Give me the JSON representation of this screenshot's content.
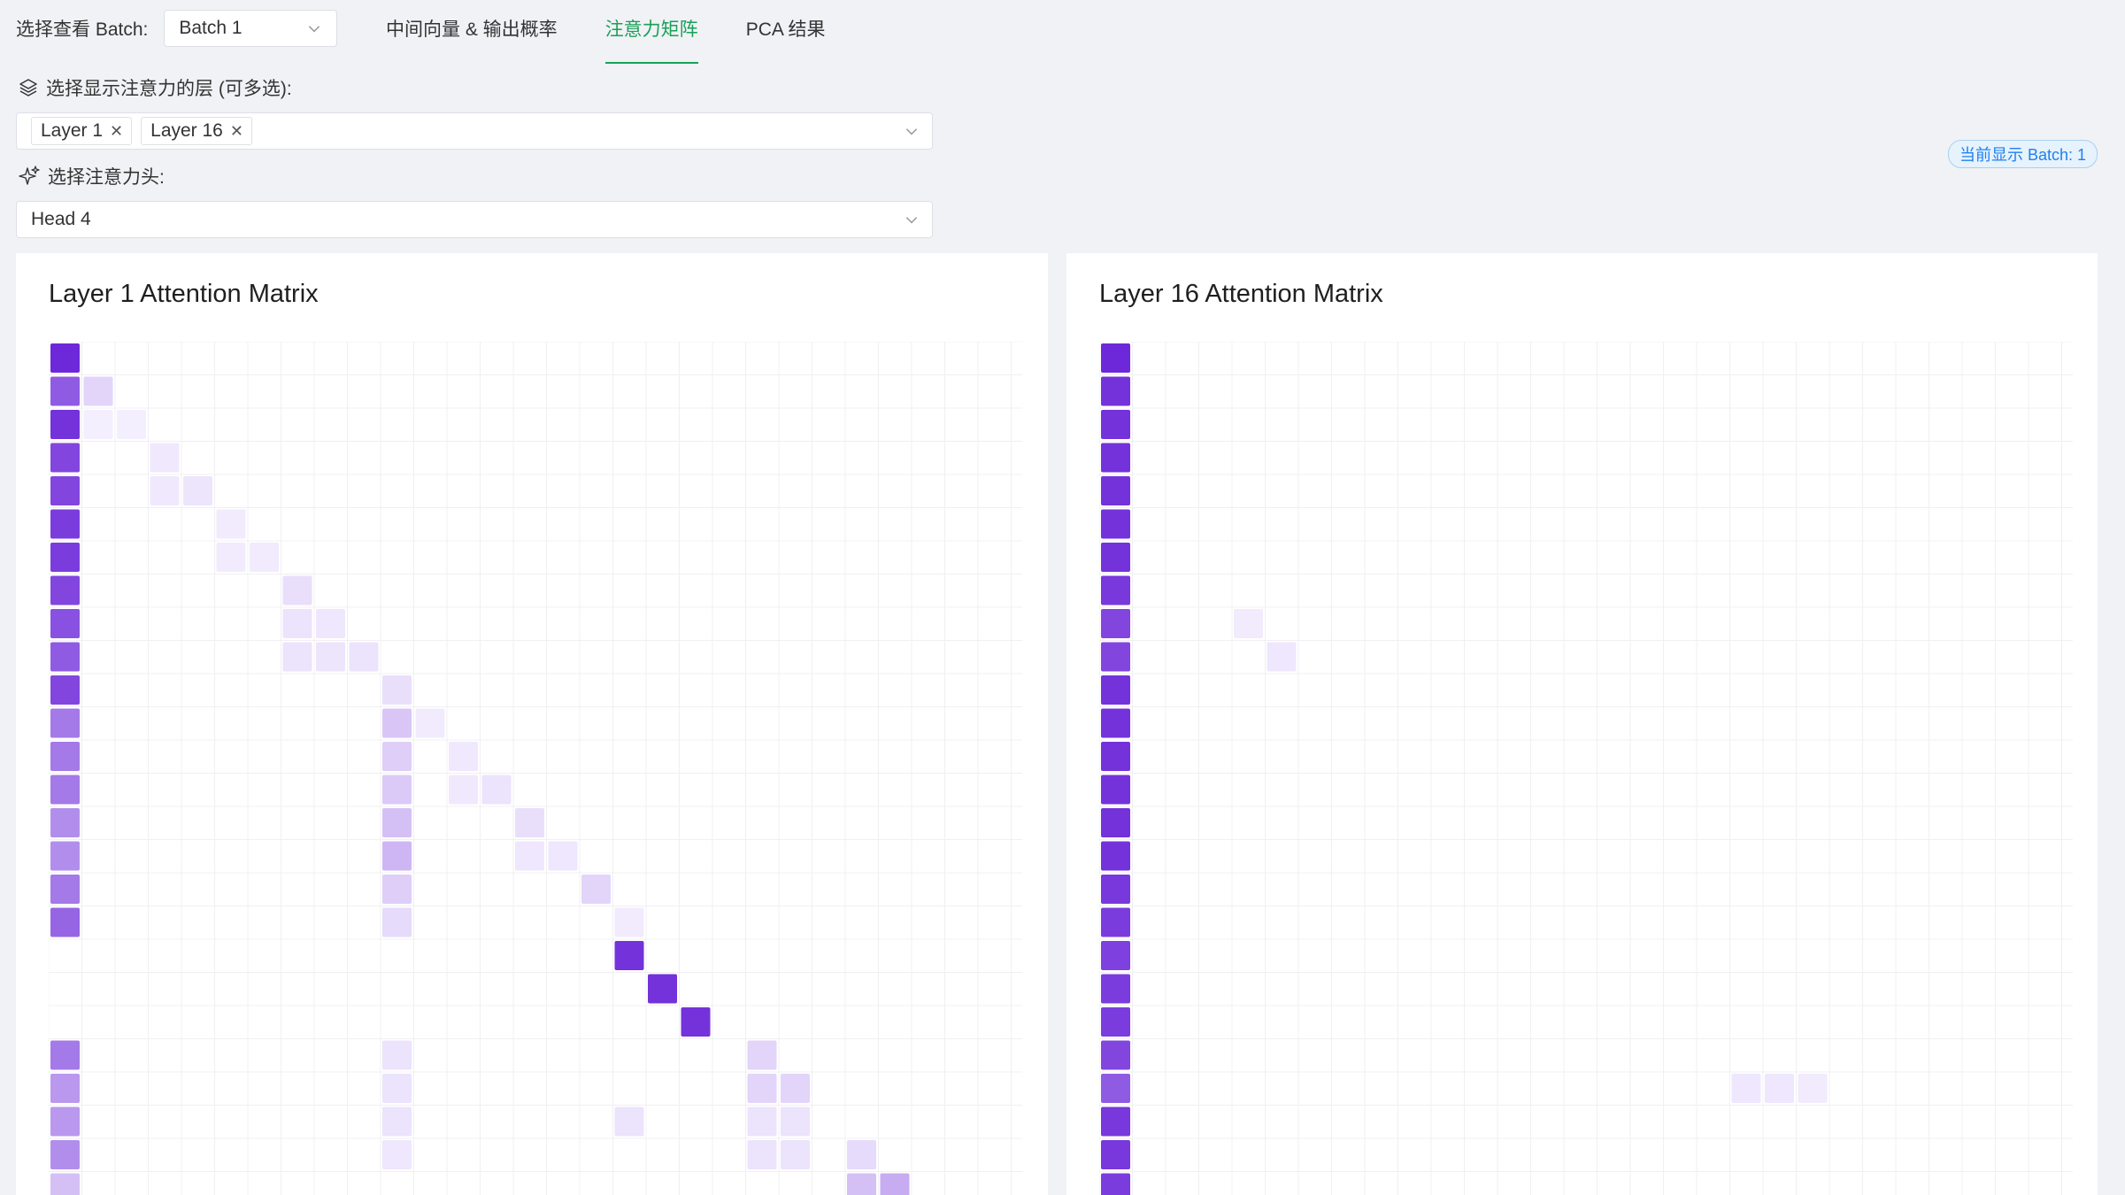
{
  "batch_selector": {
    "label": "选择查看 Batch:",
    "value": "Batch 1"
  },
  "tabs": [
    {
      "label": "中间向量 & 输出概率",
      "active": false
    },
    {
      "label": "注意力矩阵",
      "active": true
    },
    {
      "label": "PCA 结果",
      "active": false
    }
  ],
  "layer_selector": {
    "label": "选择显示注意力的层 (可多选):",
    "tags": [
      "Layer 1",
      "Layer 16"
    ]
  },
  "head_selector": {
    "label": "选择注意力头:",
    "value": "Head 4"
  },
  "status_badge": "当前显示 Batch: 1",
  "colors": {
    "accent_green": "#18a058",
    "purple_strong": "#6d28d9",
    "purple_light": "#e9d5ff"
  },
  "panels": [
    {
      "title": "Layer 1 Attention Matrix"
    },
    {
      "title": "Layer 16 Attention Matrix"
    }
  ],
  "chart_data": [
    {
      "type": "heatmap",
      "title": "Layer 1 Attention Matrix",
      "visible_rows": 26,
      "visible_cols": 30,
      "description_cells": [
        [
          0,
          0,
          1.0
        ],
        [
          1,
          0,
          0.75
        ],
        [
          1,
          1,
          0.15
        ],
        [
          2,
          0,
          0.95
        ],
        [
          2,
          1,
          0.02
        ],
        [
          2,
          2,
          0.02
        ],
        [
          3,
          0,
          0.85
        ],
        [
          3,
          3,
          0.05
        ],
        [
          4,
          0,
          0.85
        ],
        [
          4,
          3,
          0.05
        ],
        [
          4,
          4,
          0.07
        ],
        [
          5,
          0,
          0.9
        ],
        [
          5,
          5,
          0.04
        ],
        [
          6,
          0,
          0.9
        ],
        [
          6,
          5,
          0.04
        ],
        [
          6,
          6,
          0.04
        ],
        [
          7,
          0,
          0.85
        ],
        [
          7,
          7,
          0.1
        ],
        [
          8,
          0,
          0.8
        ],
        [
          8,
          7,
          0.08
        ],
        [
          8,
          8,
          0.06
        ],
        [
          9,
          0,
          0.75
        ],
        [
          9,
          7,
          0.08
        ],
        [
          9,
          8,
          0.07
        ],
        [
          9,
          9,
          0.08
        ],
        [
          10,
          0,
          0.85
        ],
        [
          10,
          10,
          0.1
        ],
        [
          11,
          0,
          0.6
        ],
        [
          11,
          10,
          0.22
        ],
        [
          11,
          11,
          0.04
        ],
        [
          12,
          0,
          0.6
        ],
        [
          12,
          10,
          0.18
        ],
        [
          12,
          12,
          0.05
        ],
        [
          13,
          0,
          0.6
        ],
        [
          13,
          10,
          0.2
        ],
        [
          13,
          12,
          0.05
        ],
        [
          13,
          13,
          0.08
        ],
        [
          14,
          0,
          0.5
        ],
        [
          14,
          10,
          0.25
        ],
        [
          14,
          14,
          0.1
        ],
        [
          15,
          0,
          0.5
        ],
        [
          15,
          10,
          0.3
        ],
        [
          15,
          14,
          0.06
        ],
        [
          15,
          15,
          0.06
        ],
        [
          16,
          0,
          0.6
        ],
        [
          16,
          10,
          0.18
        ],
        [
          16,
          16,
          0.15
        ],
        [
          17,
          0,
          0.7
        ],
        [
          17,
          10,
          0.12
        ],
        [
          17,
          17,
          0.04
        ],
        [
          18,
          17,
          0.95
        ],
        [
          19,
          18,
          0.95
        ],
        [
          20,
          19,
          0.95
        ],
        [
          21,
          0,
          0.6
        ],
        [
          21,
          10,
          0.08
        ],
        [
          21,
          21,
          0.15
        ],
        [
          22,
          0,
          0.45
        ],
        [
          22,
          10,
          0.08
        ],
        [
          22,
          21,
          0.15
        ],
        [
          22,
          22,
          0.15
        ],
        [
          23,
          0,
          0.45
        ],
        [
          23,
          10,
          0.08
        ],
        [
          23,
          17,
          0.08
        ],
        [
          23,
          21,
          0.08
        ],
        [
          23,
          22,
          0.08
        ],
        [
          24,
          0,
          0.5
        ],
        [
          24,
          10,
          0.06
        ],
        [
          24,
          21,
          0.08
        ],
        [
          24,
          22,
          0.08
        ],
        [
          24,
          24,
          0.12
        ],
        [
          25,
          0,
          0.25
        ],
        [
          25,
          24,
          0.25
        ],
        [
          25,
          25,
          0.35
        ]
      ]
    },
    {
      "type": "heatmap",
      "title": "Layer 16 Attention Matrix",
      "visible_rows": 26,
      "visible_cols": 30,
      "description_cells": [
        [
          0,
          0,
          1.0
        ],
        [
          1,
          0,
          0.95
        ],
        [
          2,
          0,
          0.95
        ],
        [
          3,
          0,
          0.95
        ],
        [
          4,
          0,
          0.95
        ],
        [
          5,
          0,
          0.95
        ],
        [
          6,
          0,
          0.95
        ],
        [
          7,
          0,
          0.92
        ],
        [
          8,
          0,
          0.85
        ],
        [
          8,
          4,
          0.04
        ],
        [
          9,
          0,
          0.85
        ],
        [
          9,
          5,
          0.06
        ],
        [
          10,
          0,
          0.95
        ],
        [
          11,
          0,
          0.95
        ],
        [
          12,
          0,
          0.95
        ],
        [
          13,
          0,
          0.95
        ],
        [
          14,
          0,
          0.95
        ],
        [
          15,
          0,
          0.95
        ],
        [
          16,
          0,
          0.92
        ],
        [
          17,
          0,
          0.9
        ],
        [
          18,
          0,
          0.88
        ],
        [
          19,
          0,
          0.9
        ],
        [
          20,
          0,
          0.9
        ],
        [
          21,
          0,
          0.85
        ],
        [
          22,
          0,
          0.75
        ],
        [
          22,
          19,
          0.06
        ],
        [
          22,
          20,
          0.06
        ],
        [
          22,
          21,
          0.04
        ],
        [
          23,
          0,
          0.92
        ],
        [
          24,
          0,
          0.92
        ],
        [
          25,
          0,
          0.9
        ]
      ]
    }
  ]
}
